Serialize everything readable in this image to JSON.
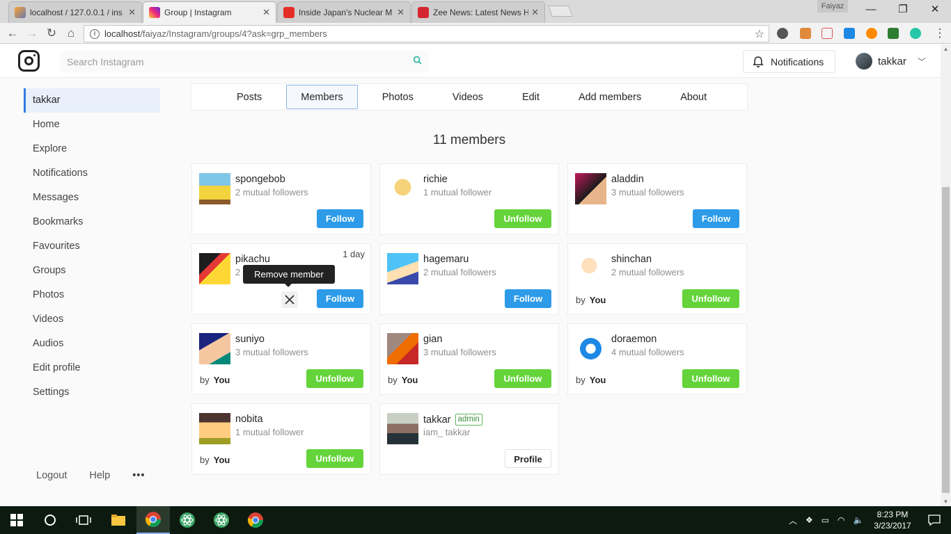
{
  "browser": {
    "tabs": [
      {
        "title": "localhost / 127.0.0.1 / ins",
        "active": false
      },
      {
        "title": "Group | Instagram",
        "active": true
      },
      {
        "title": "Inside Japan's Nuclear M",
        "active": false
      },
      {
        "title": "Zee News: Latest News H",
        "active": false
      }
    ],
    "profile_name": "Faiyaz",
    "url_host": "localhost",
    "url_path": "/faiyaz/Instagram/groups/4?ask=grp_members"
  },
  "header": {
    "search_placeholder": "Search Instagram",
    "notifications_label": "Notifications",
    "username": "takkar"
  },
  "sidebar": {
    "items": [
      "takkar",
      "Home",
      "Explore",
      "Notifications",
      "Messages",
      "Bookmarks",
      "Favourites",
      "Groups",
      "Photos",
      "Videos",
      "Audios",
      "Edit profile",
      "Settings"
    ],
    "active_item": "takkar",
    "bottom": {
      "logout": "Logout",
      "help": "Help",
      "more": "•••"
    }
  },
  "group_tabs": [
    "Posts",
    "Members",
    "Photos",
    "Videos",
    "Edit",
    "Add members",
    "About"
  ],
  "active_tab": "Members",
  "member_count": "11 members",
  "members": [
    {
      "name": "spongebob",
      "sub": "2 mutual followers",
      "action": "Follow",
      "by": "",
      "by_user": ""
    },
    {
      "name": "richie",
      "sub": "1 mutual follower",
      "action": "Unfollow",
      "by": "",
      "by_user": ""
    },
    {
      "name": "aladdin",
      "sub": "3 mutual followers",
      "action": "Follow",
      "by": "",
      "by_user": ""
    },
    {
      "name": "pikachu",
      "sub": "2",
      "action": "Follow",
      "by": "",
      "by_user": "",
      "time": "1 day"
    },
    {
      "name": "hagemaru",
      "sub": "2 mutual followers",
      "action": "Follow",
      "by": "",
      "by_user": ""
    },
    {
      "name": "shinchan",
      "sub": "2 mutual followers",
      "action": "Unfollow",
      "by": "by",
      "by_user": "You"
    },
    {
      "name": "suniyo",
      "sub": "3 mutual followers",
      "action": "Unfollow",
      "by": "by",
      "by_user": "You"
    },
    {
      "name": "gian",
      "sub": "3 mutual followers",
      "action": "Unfollow",
      "by": "by",
      "by_user": "You"
    },
    {
      "name": "doraemon",
      "sub": "4 mutual followers",
      "action": "Unfollow",
      "by": "by",
      "by_user": "You"
    },
    {
      "name": "nobita",
      "sub": "1 mutual follower",
      "action": "Unfollow",
      "by": "by",
      "by_user": "You"
    },
    {
      "name": "takkar",
      "sub": "iam_ takkar",
      "action": "Profile",
      "badge": "admin",
      "by": "",
      "by_user": ""
    }
  ],
  "tooltip": "Remove member",
  "taskbar": {
    "time": "8:23 PM",
    "date": "3/23/2017"
  },
  "colors": {
    "follow": "#2d9be8",
    "unfollow": "#64d43a",
    "active_tab_border": "#8db3e6",
    "sidebar_active": "#2f7de1"
  }
}
